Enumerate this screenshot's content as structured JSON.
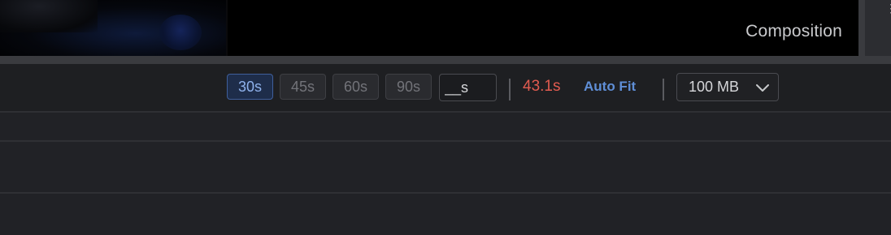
{
  "preview": {
    "title": "Composition"
  },
  "toolbar": {
    "durations": [
      {
        "label": "30s",
        "active": true
      },
      {
        "label": "45s",
        "active": false
      },
      {
        "label": "60s",
        "active": false
      },
      {
        "label": "90s",
        "active": false
      }
    ],
    "custom_duration_value": "__s",
    "current_duration": "43.1s",
    "auto_fit_label": "Auto Fit",
    "size_select": {
      "selected": "100 MB"
    }
  },
  "colors": {
    "duration_warning": "#e15b50",
    "accent": "#5f8ed6",
    "active_chip_bg": "#1e2d4a"
  },
  "icons": {
    "size_select": "chevron-down-icon"
  }
}
